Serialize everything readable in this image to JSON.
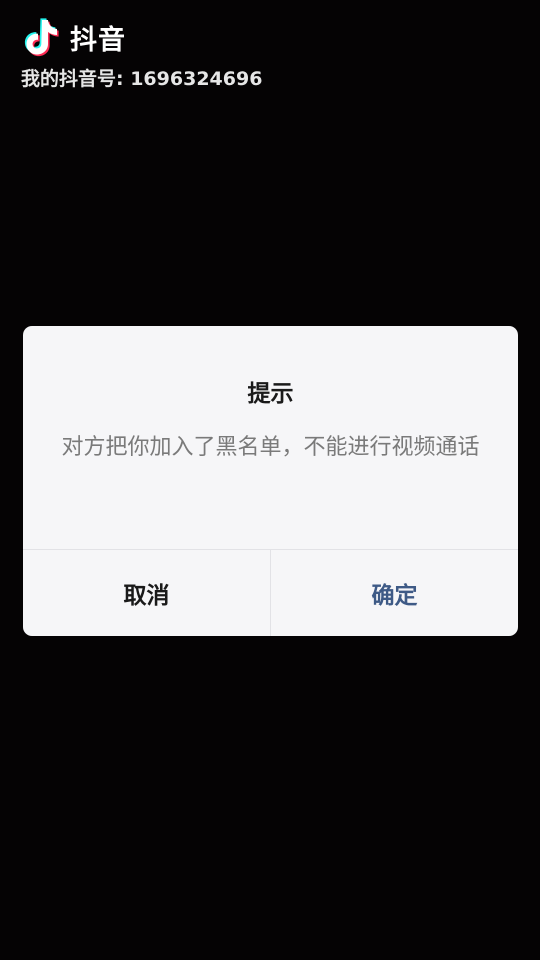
{
  "watermark": {
    "brand": "抖音",
    "id_line": "我的抖音号: 1696324696",
    "logo_icon": "tiktok-note-icon"
  },
  "dialog": {
    "title": "提示",
    "message": "对方把你加入了黑名单，不能进行视频通话",
    "cancel_label": "取消",
    "confirm_label": "确定"
  },
  "colors": {
    "background": "#050304",
    "dialog_bg": "#f6f6f8",
    "confirm_text": "#3e5a86",
    "message_text": "#7a7a7a"
  }
}
